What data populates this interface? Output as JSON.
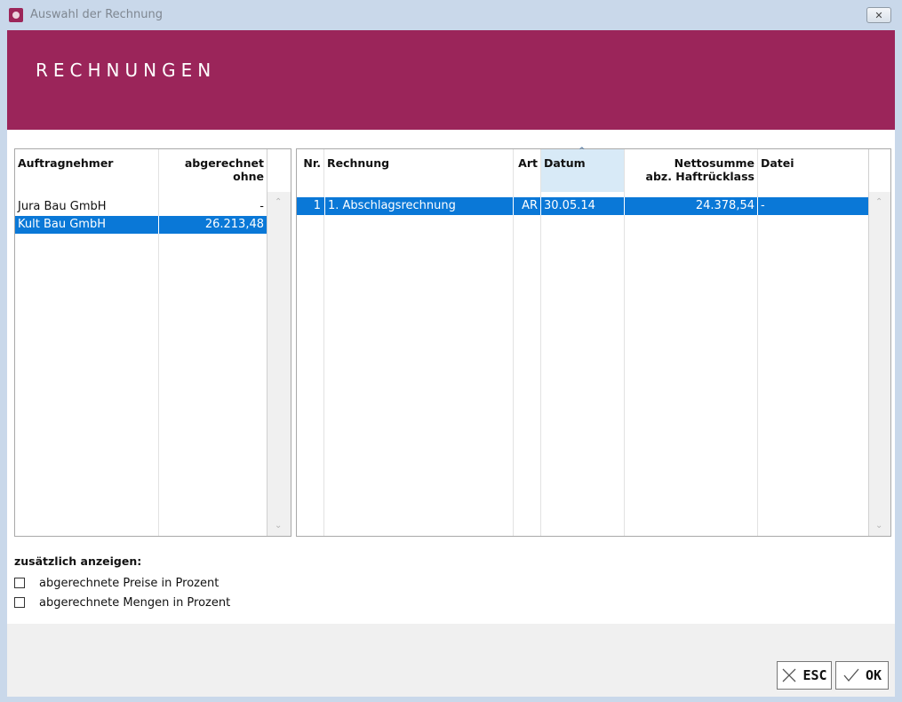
{
  "window": {
    "title": "Auswahl der Rechnung",
    "close_glyph": "✕"
  },
  "banner": {
    "title": "RECHNUNGEN"
  },
  "left_table": {
    "columns": {
      "auftragnehmer": "Auftragnehmer",
      "abgerechnet_line1": "abgerechnet",
      "abgerechnet_line2": "ohne"
    },
    "rows": [
      {
        "name": "Jura Bau GmbH",
        "value": "-"
      },
      {
        "name": "Kult Bau GmbH",
        "value": "26.213,48"
      }
    ]
  },
  "right_table": {
    "columns": {
      "nr": "Nr.",
      "rechnung": "Rechnung",
      "art": "Art",
      "datum": "Datum",
      "netto_line1": "Nettosumme",
      "netto_line2": "abz. Haftrücklass",
      "datei": "Datei"
    },
    "rows": [
      {
        "nr": "1",
        "rechnung": "1. Abschlagsrechnung",
        "art": "AR",
        "datum": "30.05.14",
        "netto": "24.378,54",
        "datei": "-"
      }
    ]
  },
  "options": {
    "title": "zusätzlich anzeigen:",
    "items": [
      {
        "label": "abgerechnete Preise in Prozent",
        "checked": false
      },
      {
        "label": "abgerechnete Mengen in Prozent",
        "checked": false
      }
    ]
  },
  "buttons": {
    "esc_label": "ESC",
    "ok_label": "OK"
  },
  "colors": {
    "brand": "#9b255a",
    "selection": "#0a78d7",
    "sort_column": "#d8eaf7"
  }
}
